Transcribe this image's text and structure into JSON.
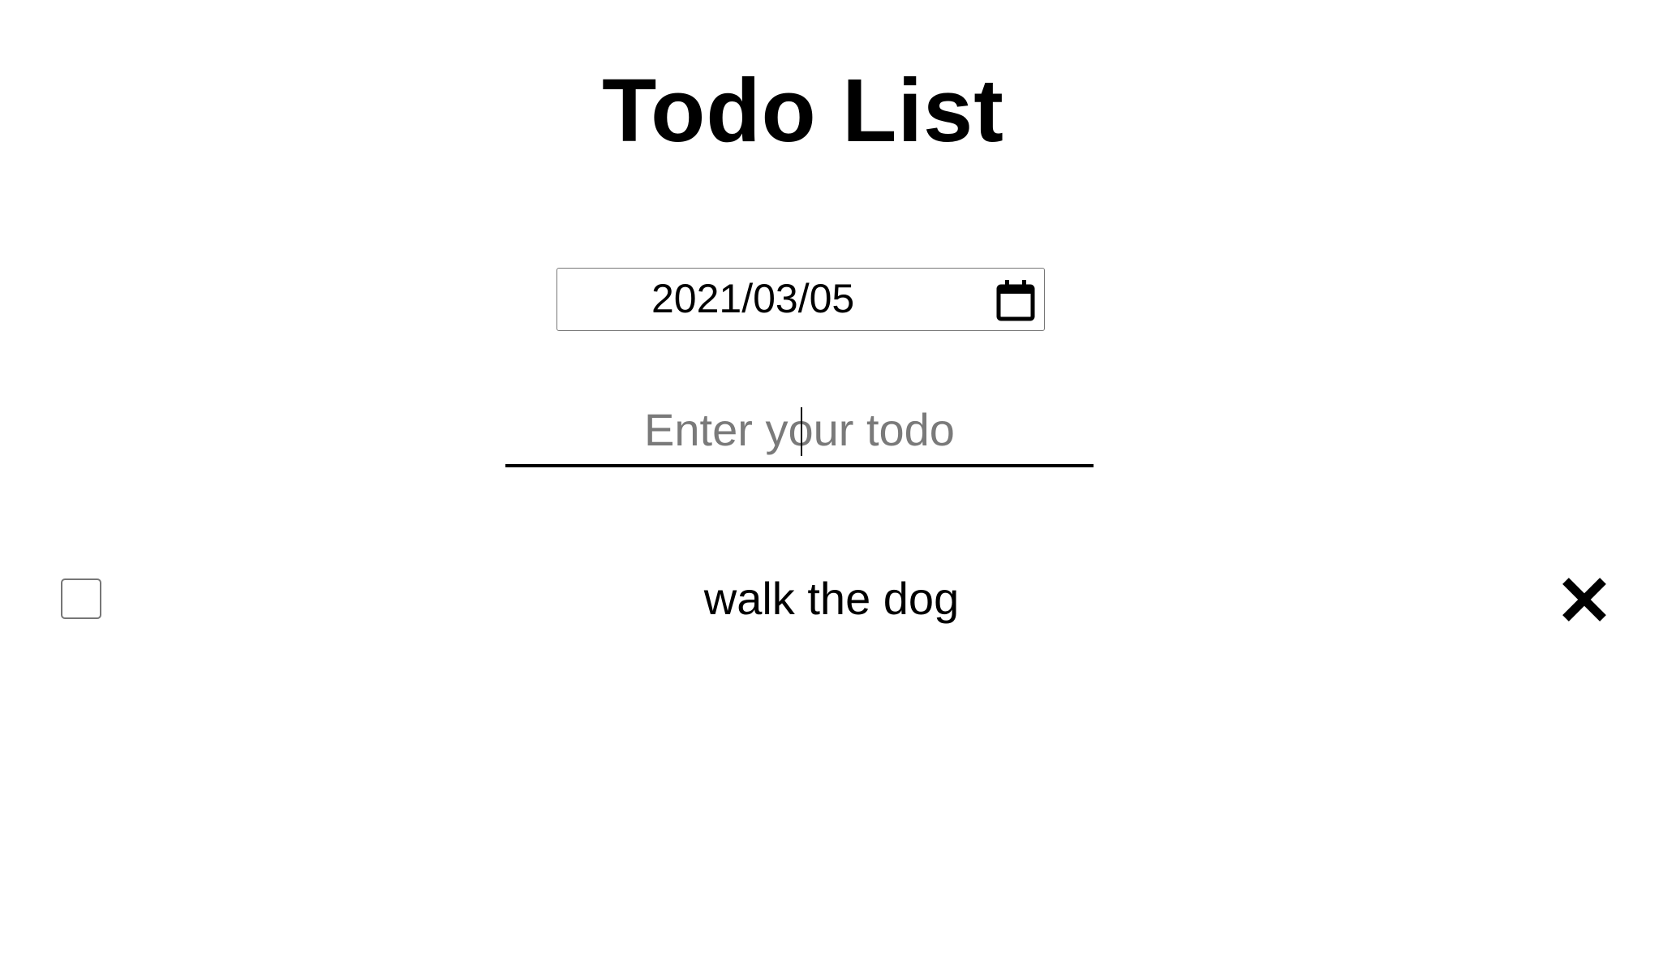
{
  "header": {
    "title": "Todo List"
  },
  "date_input": {
    "value": "2021/03/05",
    "icon": "calendar-icon"
  },
  "todo_input": {
    "placeholder": "Enter your todo",
    "value": ""
  },
  "todos": [
    {
      "text": "walk the dog",
      "completed": false,
      "delete_icon": "close-icon"
    }
  ],
  "colors": {
    "text": "#000000",
    "placeholder": "#7a7a7a",
    "border": "#767676",
    "background": "#ffffff"
  }
}
